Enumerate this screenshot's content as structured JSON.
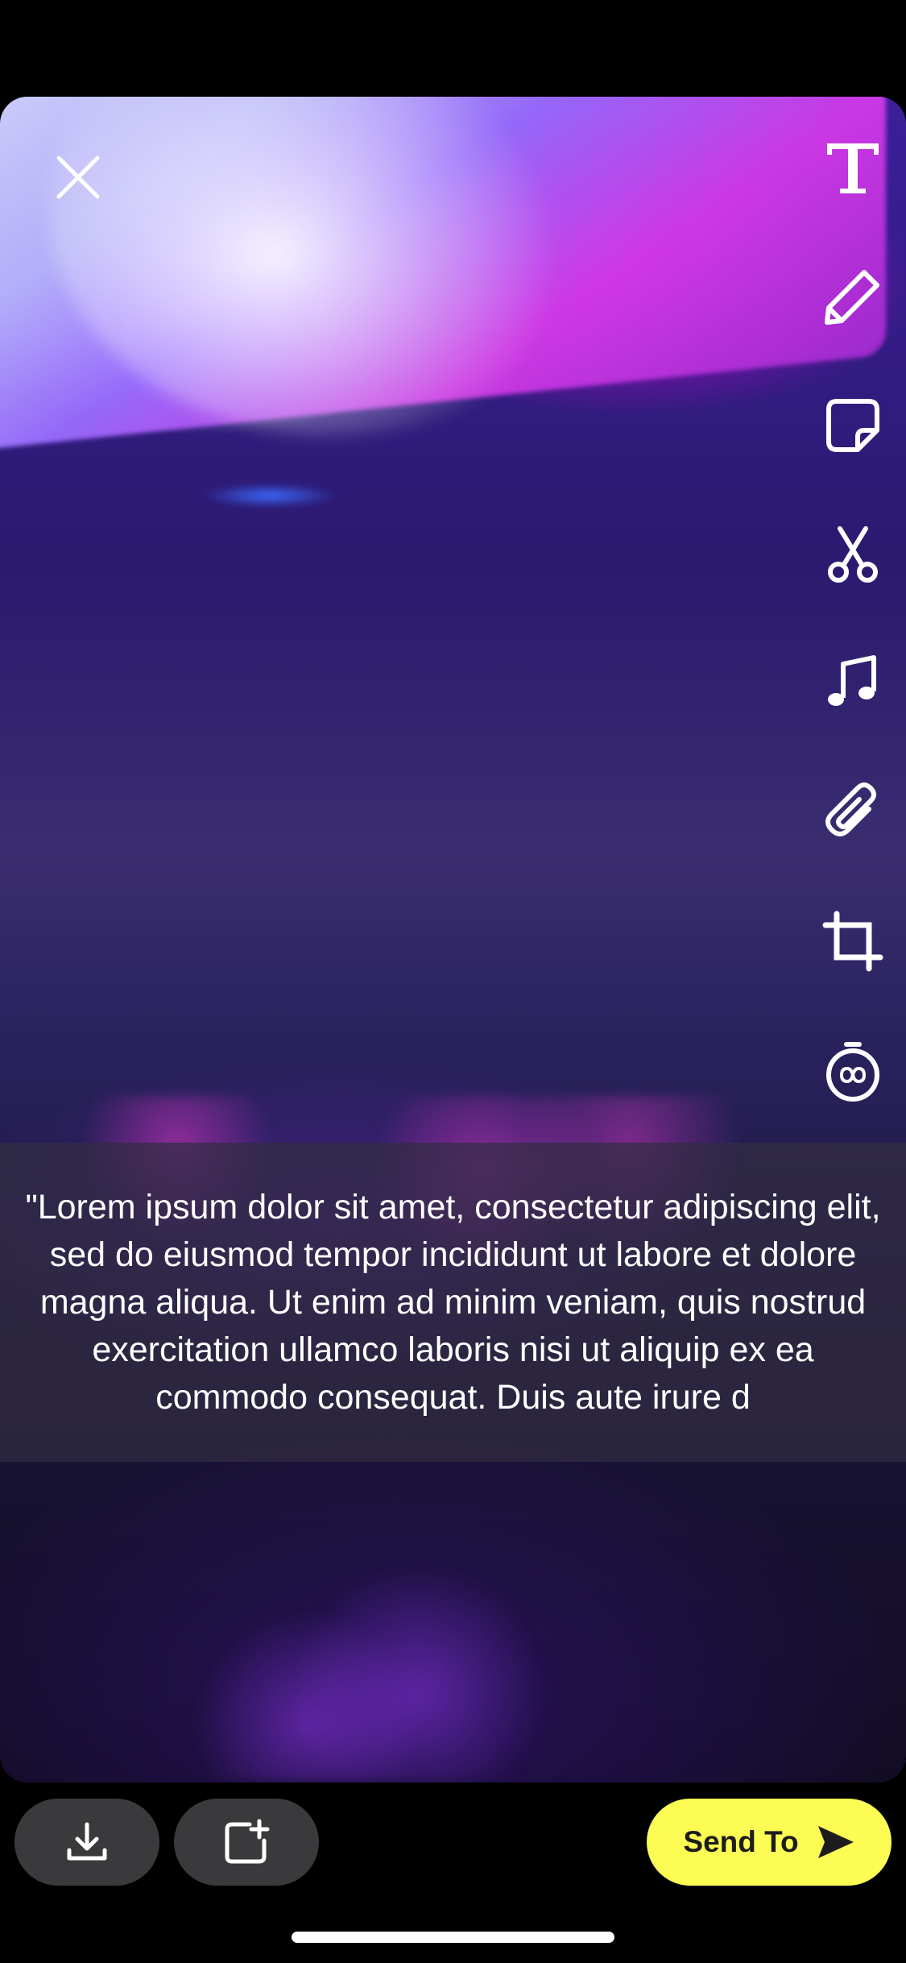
{
  "caption": {
    "text": "\"Lorem ipsum dolor sit amet, consectetur adipiscing elit, sed do eiusmod tempor incididunt ut labore et dolore magna aliqua. Ut enim ad minim veniam, quis nostrud exercitation ullamco laboris nisi ut aliquip ex ea commodo consequat. Duis aute irure d"
  },
  "toolbar": {
    "items": [
      {
        "icon": "text-icon"
      },
      {
        "icon": "pencil-icon"
      },
      {
        "icon": "sticker-icon"
      },
      {
        "icon": "scissors-icon"
      },
      {
        "icon": "music-icon"
      },
      {
        "icon": "paperclip-icon"
      },
      {
        "icon": "crop-icon"
      },
      {
        "icon": "timer-icon"
      }
    ]
  },
  "bottom_bar": {
    "save_icon": "download-icon",
    "story_icon": "add-story-icon",
    "send_label": "Send To",
    "send_icon": "send-arrow-icon"
  },
  "colors": {
    "send_button": "#fcfc55",
    "pill_button": "#3a3a3c",
    "caption_background": "rgba(50,44,66,0.72)"
  }
}
